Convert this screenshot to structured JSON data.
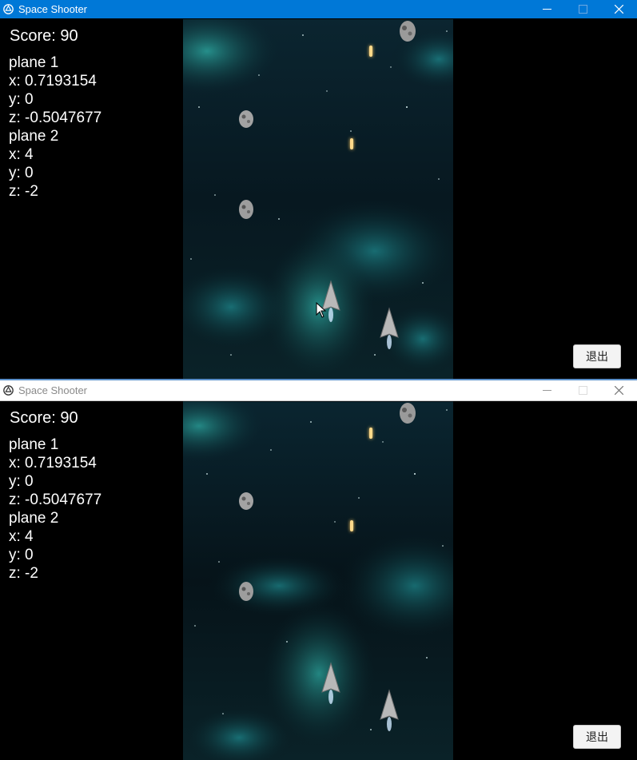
{
  "windows": [
    {
      "title": "Space Shooter",
      "state": "active",
      "score_text": "Score: 90",
      "info_lines": [
        "plane 1",
        "x: 0.7193154",
        "y: 0",
        "z: -0.5047677",
        "plane 2",
        "x: 4",
        "y: 0",
        "z: -2"
      ],
      "exit_label": "退出"
    },
    {
      "title": "Space Shooter",
      "state": "inactive",
      "score_text": "Score: 90",
      "info_lines": [
        "plane 1",
        "x: 0.7193154",
        "y: 0",
        "z: -0.5047677",
        "plane 2",
        "x: 4",
        "y: 0",
        "z: -2"
      ],
      "exit_label": "退出"
    }
  ],
  "icons": {
    "app": "unity-icon",
    "minimize": "minimize-icon",
    "maximize": "maximize-icon",
    "close": "close-icon"
  },
  "colors": {
    "titlebar_active": "#0078d7",
    "titlebar_inactive": "#ffffff",
    "nebula": "#1a8a8a",
    "space": "#061218"
  }
}
